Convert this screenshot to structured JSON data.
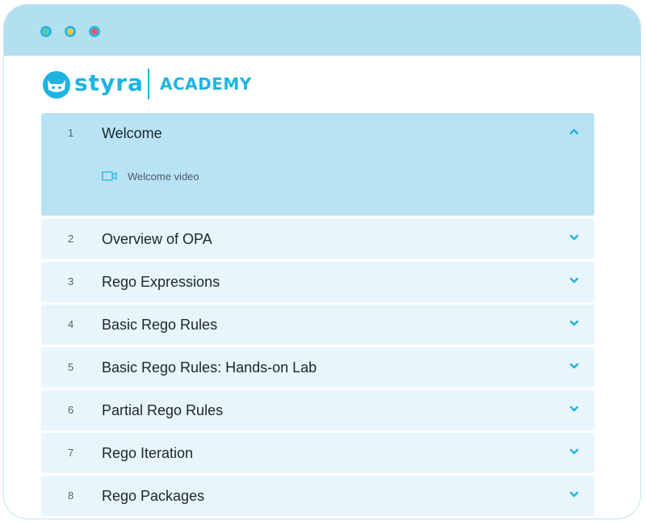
{
  "window": {
    "controls": [
      "green-dot",
      "yellow-dot",
      "red-dot"
    ]
  },
  "header": {
    "logo_text": "styra",
    "product": "ACADEMY"
  },
  "modules": [
    {
      "num": "1",
      "title": "Welcome",
      "expanded": true,
      "lessons": [
        {
          "icon": "video-icon",
          "label": "Welcome video"
        }
      ]
    },
    {
      "num": "2",
      "title": "Overview of OPA",
      "expanded": false
    },
    {
      "num": "3",
      "title": "Rego Expressions",
      "expanded": false
    },
    {
      "num": "4",
      "title": "Basic Rego Rules",
      "expanded": false
    },
    {
      "num": "5",
      "title": "Basic Rego Rules: Hands-on Lab",
      "expanded": false
    },
    {
      "num": "6",
      "title": "Partial Rego Rules",
      "expanded": false
    },
    {
      "num": "7",
      "title": "Rego Iteration",
      "expanded": false
    },
    {
      "num": "8",
      "title": "Rego Packages",
      "expanded": false
    }
  ],
  "colors": {
    "brand": "#1eb4e2",
    "titlebar": "#b3e0f0",
    "row": "#e8f5fc",
    "row_expanded": "#b8e3f4"
  }
}
